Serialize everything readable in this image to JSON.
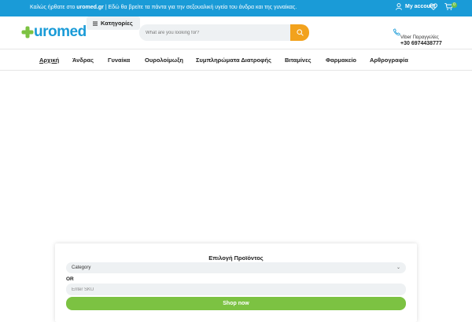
{
  "colors": {
    "brand_blue": "#1a9bd7",
    "orange": "#f2a21d",
    "green": "#7cc242",
    "badge_green": "#6cc04a"
  },
  "topbar": {
    "message_before": "Καλώς ήρθατε στο ",
    "message_site": "uromed.gr",
    "message_after": " | Εδώ θα βρείτε τα πάντα για την σεξουαλική υγεία του άνδρα και της γυναίκας.",
    "account_label": "My account",
    "cart_count": "0",
    "icons": {
      "account": "user-icon",
      "wishlist": "heart-icon",
      "cart": "cart-icon"
    }
  },
  "header": {
    "logo_text": "uromed",
    "categories_label": "Κατηγορίες",
    "search_placeholder": "What are you looking for?",
    "viber_label": "Viber Παραγγελίες",
    "phone": "+30 6974438777",
    "icons": {
      "categories": "menu-icon",
      "search": "search-icon",
      "phone": "phone-icon"
    }
  },
  "nav": {
    "items": [
      {
        "label": "Αρχική",
        "active": true
      },
      {
        "label": "Άνδρας"
      },
      {
        "label": "Γυναίκα"
      },
      {
        "label": "Ουρολοίμωξη"
      },
      {
        "label": "Συμπληρώματα Διατροφής"
      },
      {
        "label": "Βιταμίνες"
      },
      {
        "label": "Φαρμακείο"
      },
      {
        "label": "Αρθρογραφία"
      }
    ]
  },
  "product_finder": {
    "title": "Επιλογή Προϊόντος",
    "category_value": "Category",
    "or_label": "OR",
    "sku_placeholder": "Enter SKU",
    "shop_button": "Shop now"
  }
}
